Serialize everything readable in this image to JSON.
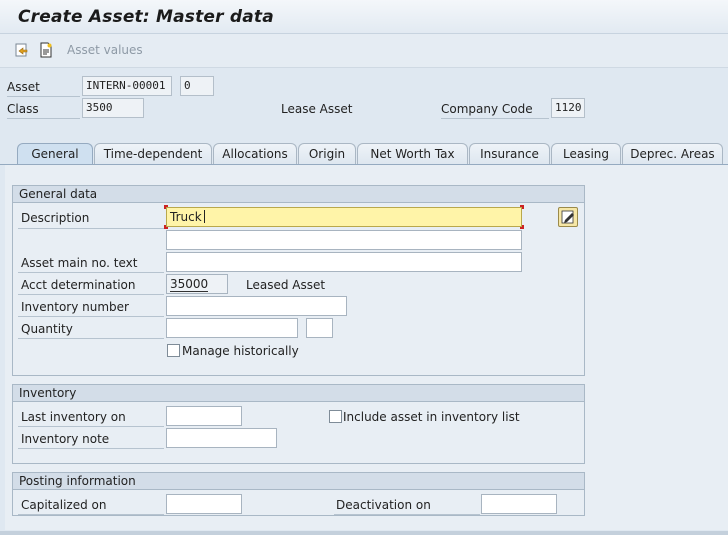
{
  "window": {
    "title": "Create Asset:  Master data"
  },
  "toolbar": {
    "asset_values_label": "Asset values",
    "icons": [
      "other-asset-icon",
      "new-document-icon"
    ]
  },
  "header": {
    "asset_label": "Asset",
    "asset_value": "INTERN-00001",
    "subnumber_value": "0",
    "class_label": "Class",
    "class_value": "3500",
    "lease_asset_label": "Lease Asset",
    "company_code_label": "Company Code",
    "company_code_value": "1120"
  },
  "tabs": [
    {
      "label": "General",
      "active": true
    },
    {
      "label": "Time-dependent"
    },
    {
      "label": "Allocations"
    },
    {
      "label": "Origin"
    },
    {
      "label": "Net Worth Tax"
    },
    {
      "label": "Insurance"
    },
    {
      "label": "Leasing"
    },
    {
      "label": "Deprec. Areas"
    }
  ],
  "general_data": {
    "group_title": "General data",
    "description_label": "Description",
    "description_value": "Truck",
    "description2_value": "",
    "main_text_label": "Asset main no. text",
    "main_text_value": "",
    "acct_det_label": "Acct determination",
    "acct_det_value": "35000",
    "acct_det_text": "Leased Asset",
    "inventory_number_label": "Inventory number",
    "inventory_number_value": "",
    "quantity_label": "Quantity",
    "quantity_value": "",
    "quantity_unit": "",
    "manage_hist_label": "Manage historically",
    "manage_hist_checked": false
  },
  "inventory": {
    "group_title": "Inventory",
    "last_inventory_label": "Last inventory on",
    "last_inventory_value": "",
    "include_label": "Include asset in inventory list",
    "include_checked": false,
    "inventory_note_label": "Inventory note",
    "inventory_note_value": ""
  },
  "posting": {
    "group_title": "Posting information",
    "capitalized_label": "Capitalized on",
    "capitalized_value": "",
    "deactivation_label": "Deactivation on",
    "deactivation_value": ""
  },
  "colors": {
    "focus_field": "#fff4a8",
    "group_header": "#d3dde8",
    "background": "#dfe8f1"
  }
}
